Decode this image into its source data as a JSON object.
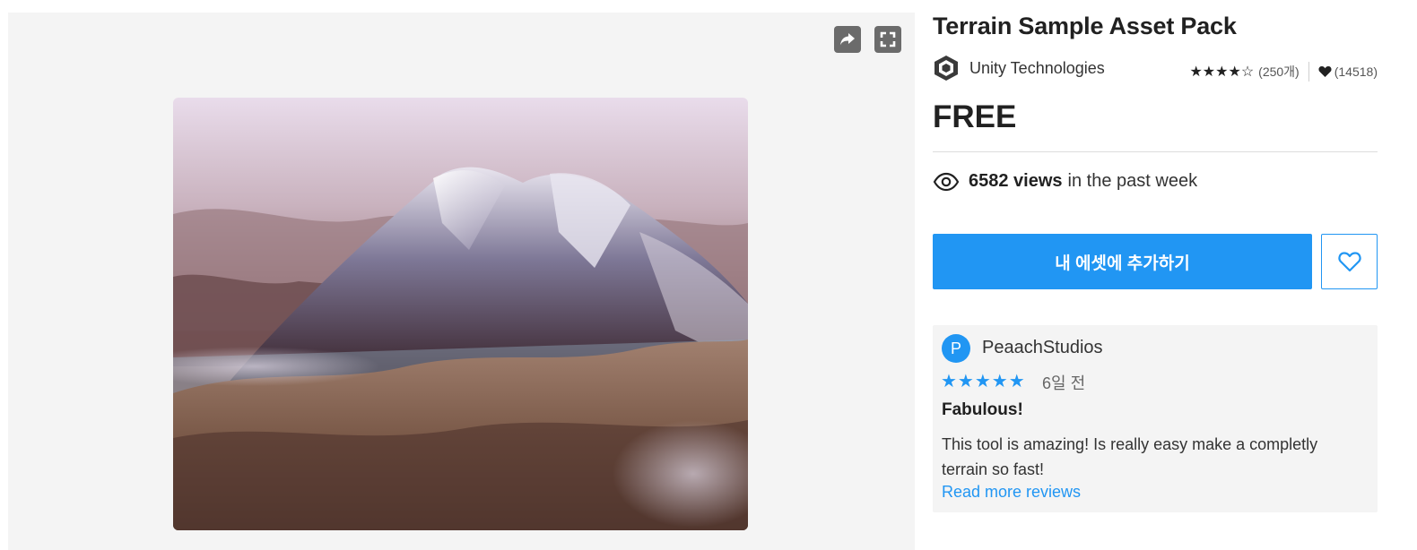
{
  "product": {
    "title": "Terrain Sample Asset Pack",
    "publisher": "Unity Technologies",
    "rating_stars": "★★★★☆",
    "rating_count": "(250개)",
    "favorites": "(14518)",
    "price": "FREE"
  },
  "views": {
    "count": "6582 views",
    "suffix": "in the past week"
  },
  "actions": {
    "add_label": "내 에셋에 추가하기"
  },
  "review": {
    "avatar_letter": "P",
    "author": "PeaachStudios",
    "stars": "★★★★★",
    "date": "6일 전",
    "title": "Fabulous!",
    "body": "This tool is amazing! Is really easy make a completly terrain so fast!",
    "read_more": "Read more reviews"
  },
  "icons": {
    "share": "share-icon",
    "fullscreen": "fullscreen-icon",
    "publisher_logo": "unity-logo-icon",
    "heart": "heart-icon",
    "eye": "eye-icon",
    "wishlist": "heart-outline-icon"
  },
  "colors": {
    "accent": "#2196f3",
    "text": "#212121",
    "panel": "#f4f4f4"
  }
}
